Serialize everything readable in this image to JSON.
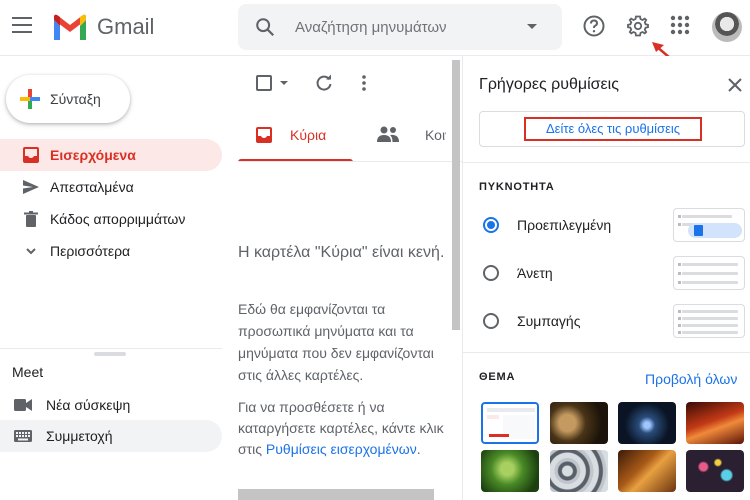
{
  "header": {
    "brand": "Gmail",
    "search_placeholder": "Αναζήτηση μηνυμάτων"
  },
  "sidebar": {
    "compose_label": "Σύνταξη",
    "items": [
      {
        "label": "Εισερχόμενα",
        "icon": "inbox-icon",
        "active": true
      },
      {
        "label": "Απεσταλμένα",
        "icon": "send-icon"
      },
      {
        "label": "Κάδος απορριμμάτων",
        "icon": "trash-icon"
      },
      {
        "label": "Περισσότερα",
        "icon": "chevron-down-icon"
      }
    ],
    "meet": {
      "title": "Meet",
      "items": [
        {
          "label": "Νέα σύσκεψη",
          "icon": "video-camera-icon"
        },
        {
          "label": "Συμμετοχή",
          "icon": "keyboard-icon",
          "active": true
        }
      ]
    }
  },
  "main": {
    "tabs": [
      {
        "label": "Κύρια",
        "active": true
      },
      {
        "label": "Κοινωνικά"
      }
    ],
    "empty": {
      "title": "Η καρτέλα \"Κύρια\" είναι κενή.",
      "body": "Εδώ θα εμφανίζονται τα προσωπικά μηνύματα και τα μηνύματα που δεν εμφανίζονται στις άλλες καρτέλες.",
      "body2_prefix": "Για να προσθέσετε ή να καταργήσετε καρτέλες, κάντε κλικ στις ",
      "body2_link": "Ρυθμίσεις εισερχομένων",
      "body2_suffix": "."
    }
  },
  "quick_settings": {
    "title": "Γρήγορες ρυθμίσεις",
    "see_all_label": "Δείτε όλες τις ρυθμίσεις",
    "density_title": "ΠΥΚΝΟΤΗΤΑ",
    "density_options": [
      {
        "label": "Προεπιλεγμένη",
        "checked": true
      },
      {
        "label": "Άνετη",
        "checked": false
      },
      {
        "label": "Συμπαγής",
        "checked": false
      }
    ],
    "theme_title": "ΘΕΜΑ",
    "view_all_label": "Προβολή όλων"
  },
  "colors": {
    "accent": "#1a73e8",
    "inbox_red": "#d93025",
    "highlight_red": "#d93025"
  }
}
